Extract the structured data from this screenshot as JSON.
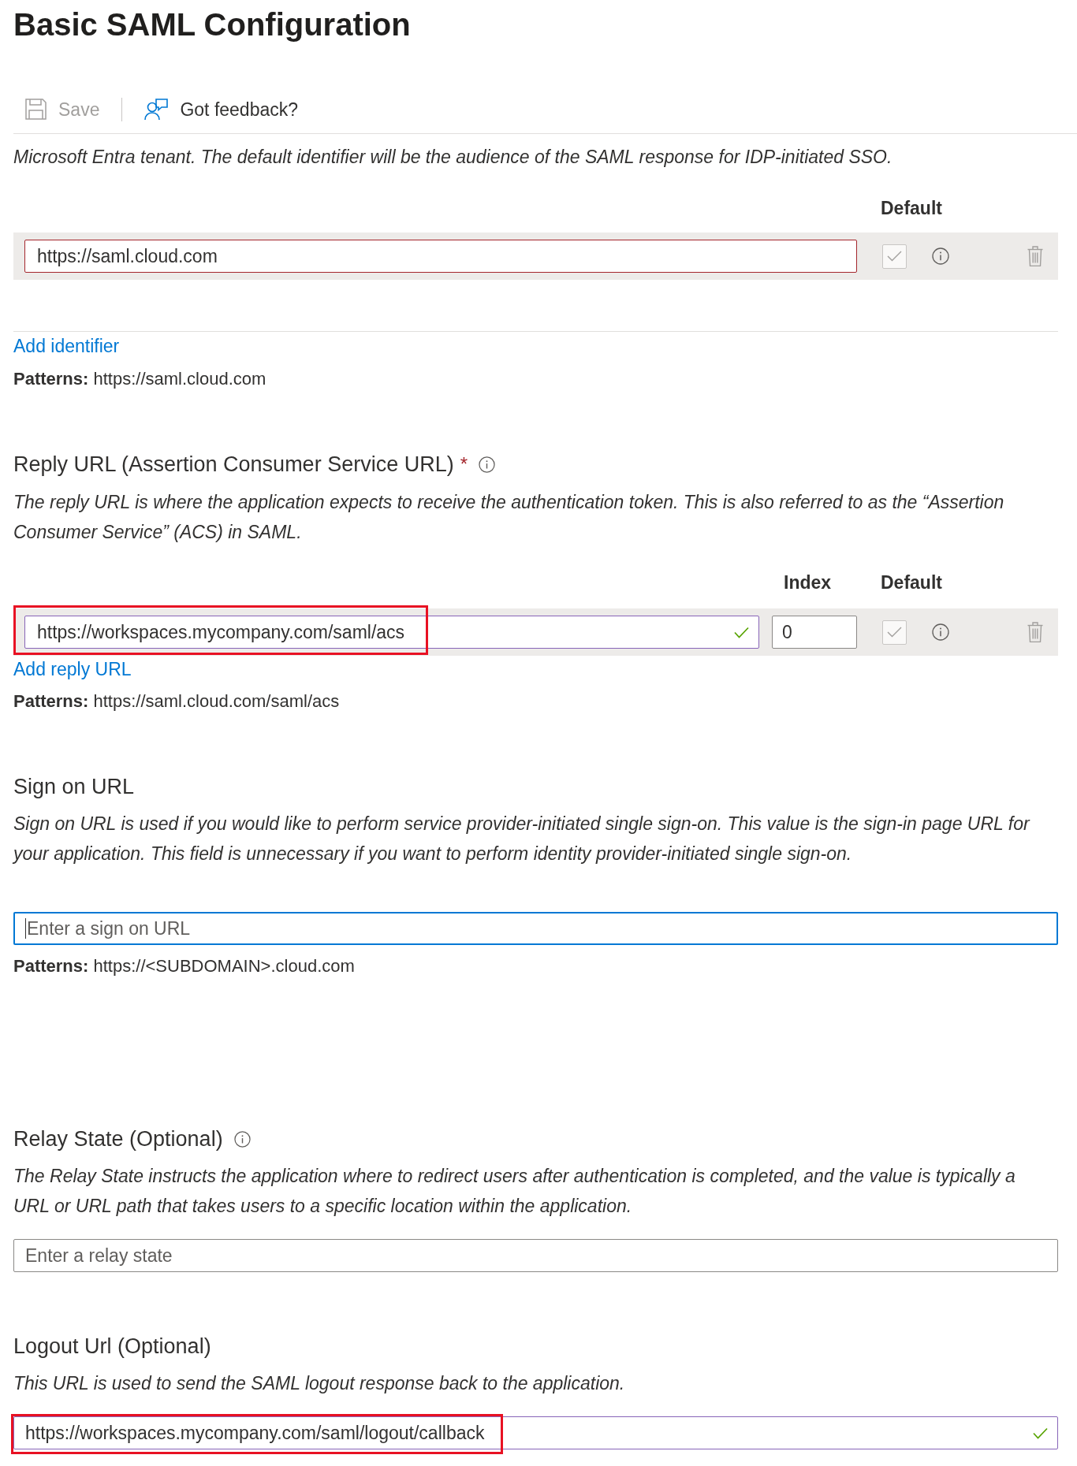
{
  "title": "Basic SAML Configuration",
  "toolbar": [
    {
      "kind": "save",
      "label": "Save",
      "disabled": true
    },
    {
      "kind": "feedback",
      "label": "Got feedback?",
      "disabled": false
    }
  ],
  "sections": [
    {
      "kind": "url_list",
      "description": "Microsoft Entra tenant. The default identifier will be the audience of the SAML response for IDP-initiated SSO.",
      "columns": [
        "Default"
      ],
      "rows": [
        {
          "value": "https://saml.cloud.com",
          "error": true,
          "valid": false,
          "highlighted": false,
          "default": {
            "checked": true,
            "disabled": true
          }
        }
      ],
      "add_link": "Add identifier",
      "patterns": "**Patterns:** https://saml.cloud.com"
    },
    {
      "kind": "url_list",
      "heading": "Reply URL (Assertion Consumer Service URL)",
      "required_mark": "*",
      "info": true,
      "description": "The reply URL is where the application expects to receive the authentication token. This is also referred to as the “Assertion Consumer Service” (ACS) in SAML.",
      "columns": [
        "Index",
        "Default"
      ],
      "rows": [
        {
          "value": "https://workspaces.mycompany.com/saml/acs",
          "error": false,
          "valid": true,
          "highlighted": true,
          "index": "0",
          "default": {
            "checked": true,
            "disabled": true
          }
        }
      ],
      "add_link": "Add reply URL",
      "patterns": "**Patterns:** https://saml.cloud.com/saml/acs"
    },
    {
      "kind": "single",
      "heading": "Sign on URL",
      "info": false,
      "description": "Sign on URL is used if you would like to perform service provider-initiated single sign-on. This value is the sign-in page URL for your application. This field is unnecessary if you want to perform identity provider-initiated single sign-on.",
      "field": {
        "placeholder": "Enter a sign on URL",
        "focused": true,
        "valid": false,
        "highlighted": false
      },
      "patterns": "**Patterns:** https://<SUBDOMAIN>.cloud.com"
    },
    {
      "kind": "single",
      "heading": "Relay State (Optional)",
      "info": true,
      "description": "The Relay State instructs the application where to redirect users after authentication is completed, and the value is typically a URL or URL path that takes users to a specific location within the application.",
      "field": {
        "placeholder": "Enter a relay state",
        "focused": false,
        "valid": false,
        "highlighted": false
      }
    },
    {
      "kind": "single",
      "heading": "Logout Url (Optional)",
      "info": false,
      "description": "This URL is used to send the SAML logout response back to the application.",
      "field": {
        "value": "https://workspaces.mycompany.com/saml/logout/callback",
        "focused": false,
        "valid": true,
        "highlighted": true
      }
    }
  ]
}
